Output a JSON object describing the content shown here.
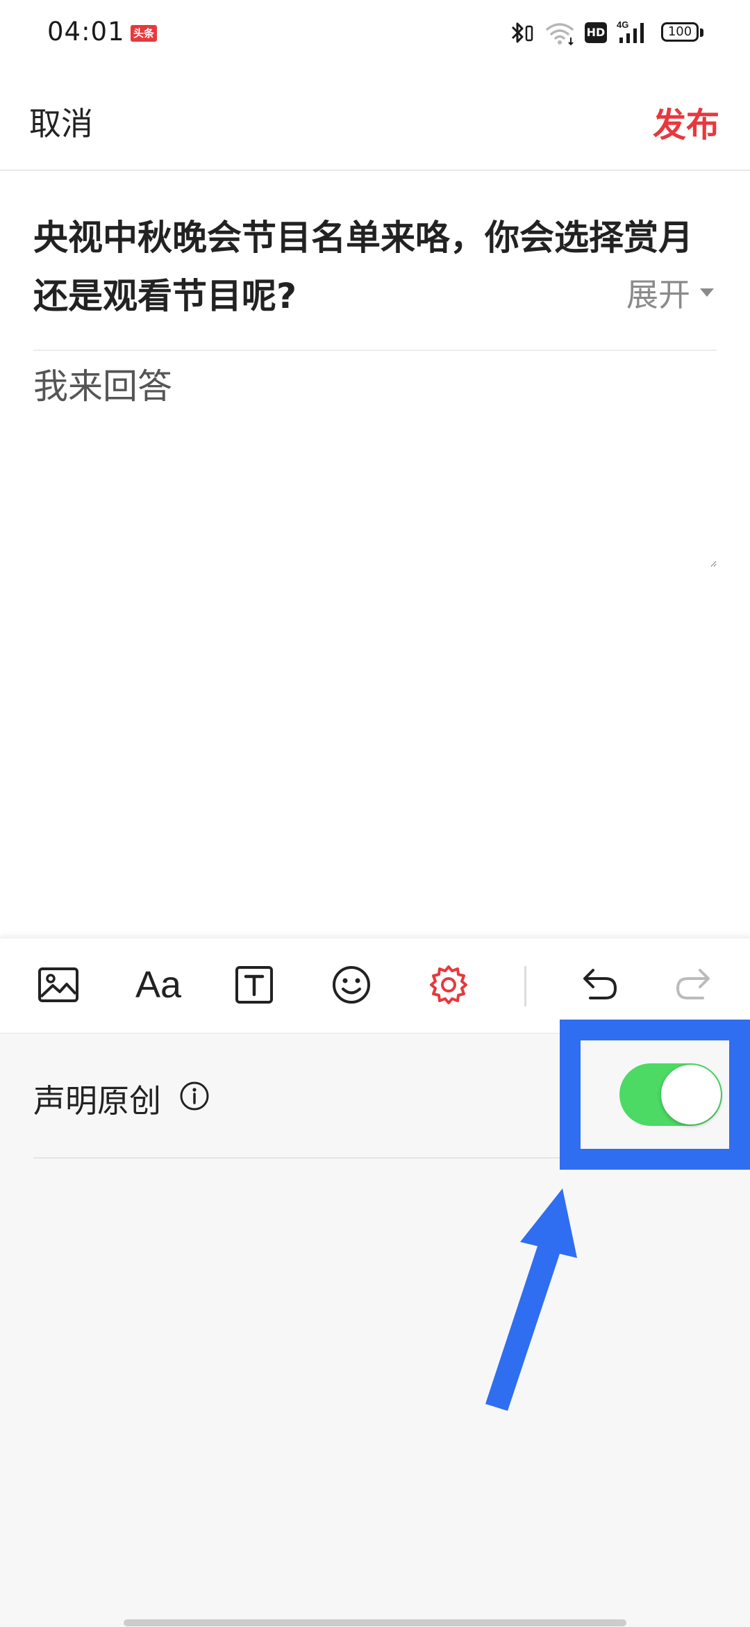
{
  "status_bar": {
    "time": "04:01",
    "app_badge": "头条",
    "hd": "HD",
    "network": "4G",
    "battery": "100",
    "icons": [
      "bluetooth-icon",
      "wifi-icon",
      "signal-icon",
      "battery-icon"
    ]
  },
  "header": {
    "cancel_label": "取消",
    "publish_label": "发布",
    "publish_color": "#e8383d"
  },
  "question": {
    "title": "央视中秋晚会节目名单来咯，你会选择赏月还是观看节目呢?",
    "expand_label": "展开"
  },
  "answer": {
    "placeholder": "我来回答"
  },
  "toolbar": {
    "tools": [
      "image-icon",
      "font-icon",
      "text-box-icon",
      "emoji-icon",
      "settings-icon",
      "undo-icon",
      "redo-icon"
    ],
    "font_label": "Aa",
    "settings_color": "#e8383d"
  },
  "settings_panel": {
    "declare_original_label": "声明原创",
    "declare_original_enabled": true,
    "toggle_color": "#4cd964"
  },
  "annotation": {
    "color": "#2f6ef0"
  }
}
